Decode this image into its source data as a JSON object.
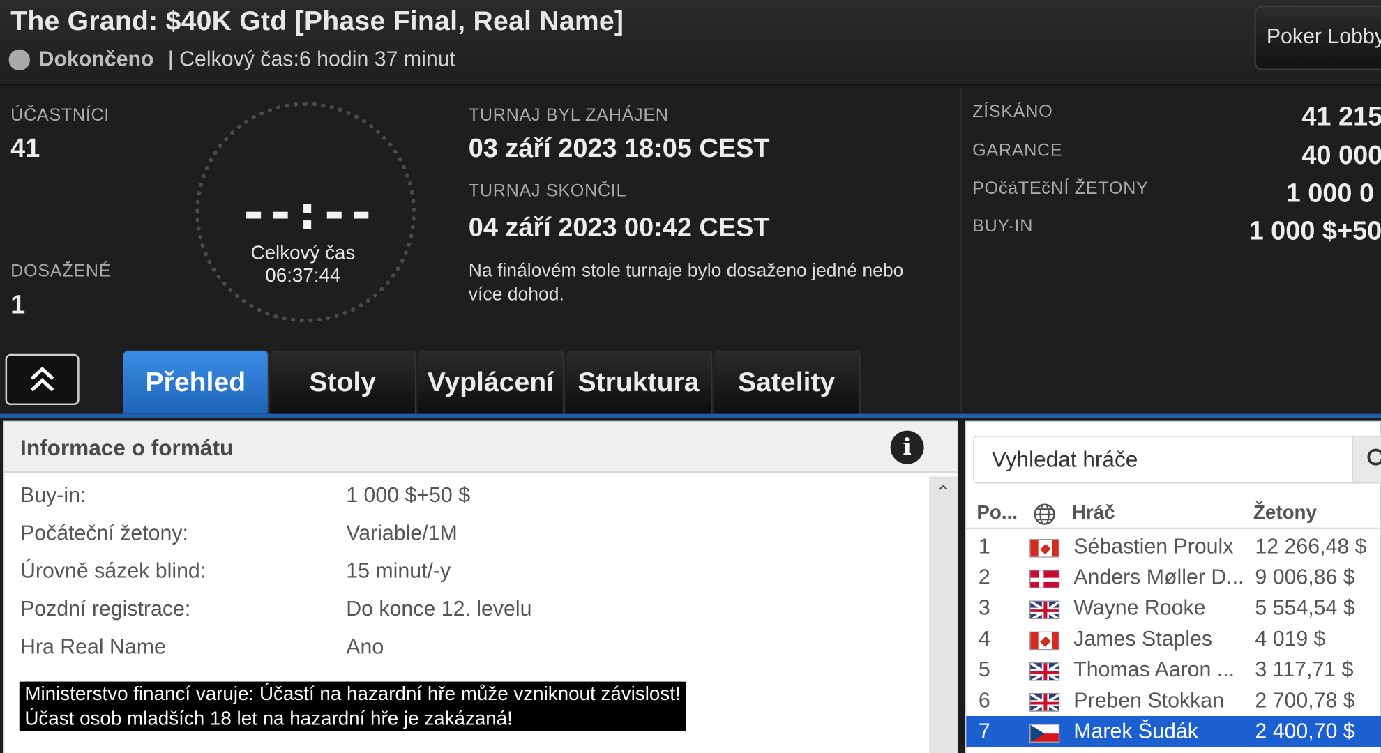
{
  "header": {
    "title": "The Grand: $40K Gtd [Phase Final, Real Name]",
    "status": "Dokončeno",
    "total_time_text": "| Celkový čas:6 hodin  37 minut",
    "lobby_button": "Poker Lobby"
  },
  "stats": {
    "participants_label": "ÚČASTNÍCI",
    "participants_value": "41",
    "reached_label": "DOSAŽENÉ",
    "reached_value": "1",
    "clock_digits": "--:--",
    "clock_label": "Celkový čas",
    "clock_time": "06:37:44",
    "started_label": "TURNAJ BYL ZAHáJEN",
    "started_value": "03 září 2023  18:05 CEST",
    "ended_label": "TURNAJ SKONčIL",
    "ended_value": "04 září 2023  00:42 CEST",
    "note": "Na finálovém stole turnaje bylo dosaženo jedné nebo více dohod."
  },
  "prize": {
    "won_label": "ZÍSKÁNO",
    "won_value": "41 215",
    "guarantee_label": "GARANCE",
    "guarantee_value": "40 000",
    "chips_label": "POčáTEčNÍ ŽETONY",
    "chips_value": "1 000 0",
    "buyin_label": "BUY-IN",
    "buyin_value": "1 000 $+50"
  },
  "tabs": [
    "Přehled",
    "Stoly",
    "Vyplácení",
    "Struktura",
    "Satelity"
  ],
  "format": {
    "title": "Informace o formátu",
    "rows": [
      {
        "label": "Buy-in:",
        "value": "1 000 $+50 $"
      },
      {
        "label": "Počáteční žetony:",
        "value": "Variable/1M"
      },
      {
        "label": "Úrovně sázek blind:",
        "value": "15 minut/-y"
      },
      {
        "label": "Pozdní registrace:",
        "value": "Do konce 12. levelu"
      },
      {
        "label": "Hra Real Name",
        "value": "Ano"
      }
    ]
  },
  "warning": {
    "line1": "Ministerstvo financí varuje: Účastí na hazardní hře může vzniknout závislost!",
    "line2": "Účast osob mladších 18 let na hazardní hře je zakázaná!"
  },
  "players": {
    "search_placeholder": "Vyhledat hráče",
    "col_pos": "Po...",
    "col_player": "Hráč",
    "col_chips": "Žetony",
    "rows": [
      {
        "pos": "1",
        "flag": "ca",
        "name": "Sébastien Proulx",
        "chips": "12 266,48 $"
      },
      {
        "pos": "2",
        "flag": "dk",
        "name": "Anders Møller D...",
        "chips": "9 006,86 $"
      },
      {
        "pos": "3",
        "flag": "gb",
        "name": "Wayne Rooke",
        "chips": "5 554,54 $"
      },
      {
        "pos": "4",
        "flag": "ca",
        "name": "James Staples",
        "chips": "4 019 $"
      },
      {
        "pos": "5",
        "flag": "gb",
        "name": "Thomas Aaron ...",
        "chips": "3 117,71 $"
      },
      {
        "pos": "6",
        "flag": "gb",
        "name": "Preben Stokkan",
        "chips": "2 700,78 $"
      },
      {
        "pos": "7",
        "flag": "cz",
        "name": "Marek Šudák",
        "chips": "2 400,70 $"
      }
    ],
    "selected_index": 6
  }
}
